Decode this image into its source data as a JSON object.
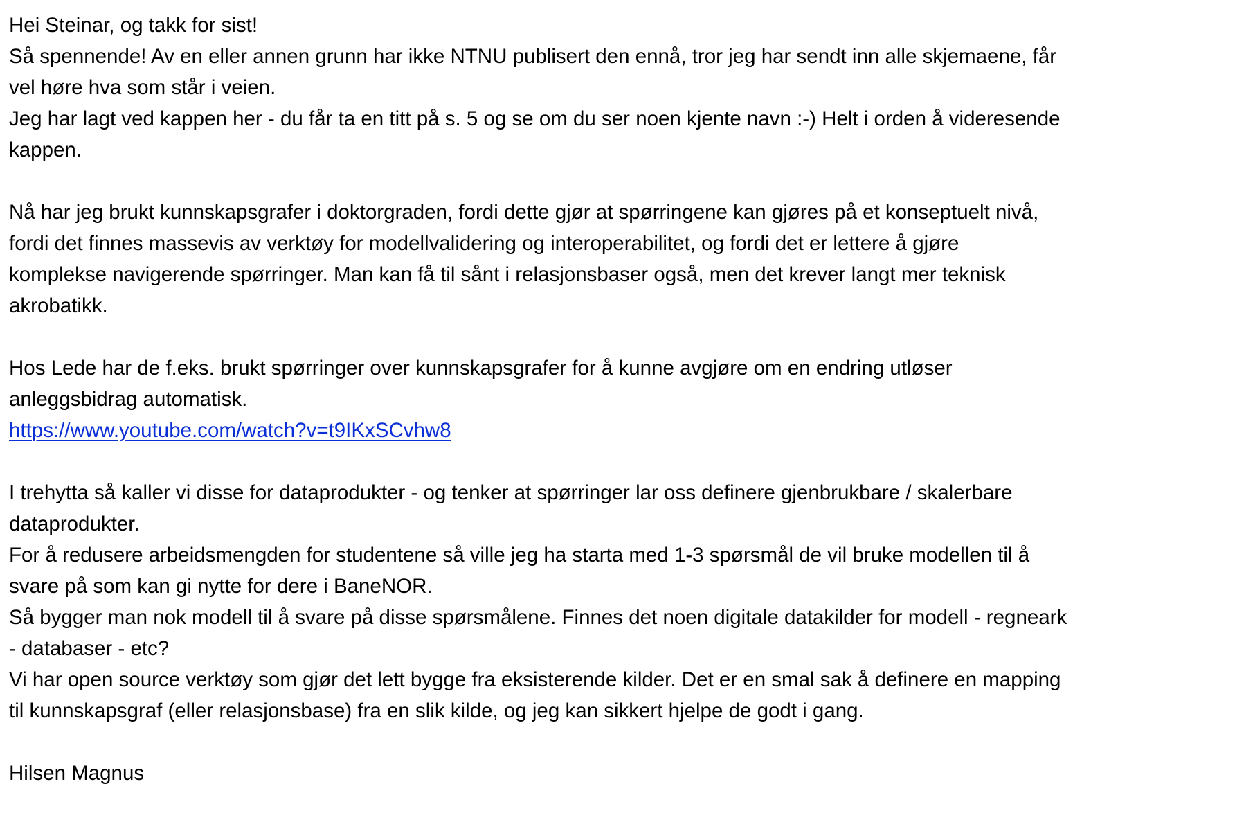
{
  "email": {
    "greeting": "Hei Steinar, og takk for sist!",
    "para1": [
      "Så spennende! Av en eller annen grunn har ikke NTNU publisert den ennå, tror jeg har sendt inn alle skjemaene, får",
      "vel høre hva som står i veien.",
      "Jeg har lagt ved kappen her - du får ta en titt på s. 5 og se om du ser noen kjente navn :-) Helt i orden å videresende",
      "kappen."
    ],
    "para2": [
      "Nå har jeg brukt kunnskapsgrafer i doktorgraden, fordi dette gjør at spørringene kan gjøres på et konseptuelt nivå,",
      "fordi det finnes massevis av verktøy for modellvalidering og interoperabilitet, og fordi det er lettere å gjøre",
      "komplekse navigerende spørringer. Man kan få til sånt i relasjonsbaser også, men det krever langt mer teknisk",
      "akrobatikk."
    ],
    "para3": [
      "Hos Lede har de f.eks. brukt spørringer over kunnskapsgrafer for å kunne avgjøre om en endring utløser",
      "anleggsbidrag automatisk."
    ],
    "link": "https://www.youtube.com/watch?v=t9IKxSCvhw8",
    "para4": [
      "I trehytta så kaller vi disse for dataprodukter - og tenker at spørringer lar oss definere gjenbrukbare / skalerbare",
      "dataprodukter.",
      "For å redusere arbeidsmengden for studentene så ville jeg ha starta med 1-3 spørsmål de vil bruke modellen til å",
      "svare på som kan gi nytte for dere i BaneNOR.",
      "Så bygger man nok modell til å svare på disse spørsmålene. Finnes det noen digitale datakilder for modell - regneark",
      "- databaser - etc?",
      "Vi har open source verktøy som gjør det lett bygge fra eksisterende kilder. Det er en smal sak å definere en mapping",
      "til kunnskapsgraf (eller relasjonsbase) fra en slik kilde, og jeg kan sikkert hjelpe de godt i gang."
    ],
    "signature": "Hilsen Magnus",
    "colors": {
      "text": "#000000",
      "link": "#0a2fd6",
      "background": "#ffffff"
    }
  }
}
